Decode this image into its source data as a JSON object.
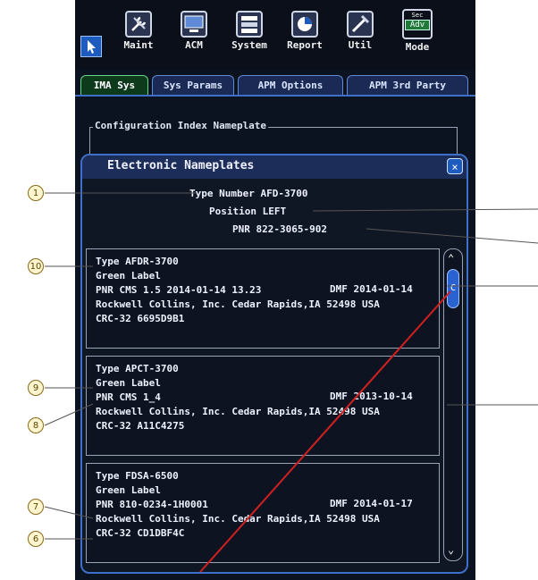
{
  "toolbar": {
    "buttons": [
      {
        "label": "Maint",
        "icon": "wrench-icon"
      },
      {
        "label": "ACM",
        "icon": "computer-icon"
      },
      {
        "label": "System",
        "icon": "network-icon"
      },
      {
        "label": "Report",
        "icon": "chart-icon"
      },
      {
        "label": "Util",
        "icon": "tools-icon"
      }
    ],
    "mode": {
      "label": "Mode",
      "sec": "Sec",
      "value": "Adv"
    }
  },
  "tabs": [
    {
      "label": "IMA Sys",
      "active": true
    },
    {
      "label": "Sys Params",
      "active": false
    },
    {
      "label": "APM Options",
      "active": false
    },
    {
      "label": "APM 3rd Party",
      "active": false
    }
  ],
  "config_frame": {
    "title": "Configuration Index Nameplate"
  },
  "dialog": {
    "title": "Electronic Nameplates",
    "close_label": "×",
    "header": {
      "type_line": "Type Number AFD-3700",
      "position_line": "Position LEFT",
      "pnr_line": "PNR 822-3065-902"
    },
    "cards": [
      {
        "type": "Type AFDR-3700",
        "label": "Green Label",
        "pnr": "PNR CMS 1.5 2014-01-14 13.23",
        "dmf": "DMF 2014-01-14",
        "mfr": "Rockwell Collins, Inc. Cedar Rapids,IA 52498 USA",
        "crc": "CRC-32 6695D9B1"
      },
      {
        "type": "Type APCT-3700",
        "label": "Green Label",
        "pnr": "PNR CMS 1_4",
        "dmf": "DMF 2013-10-14",
        "mfr": "Rockwell Collins, Inc. Cedar Rapids,IA 52498 USA",
        "crc": "CRC-32 A11C4275"
      },
      {
        "type": "Type FDSA-6500",
        "label": "Green Label",
        "pnr": "PNR 810-0234-1H0001",
        "dmf": "DMF 2014-01-17",
        "mfr": "Rockwell Collins, Inc. Cedar Rapids,IA 52498 USA",
        "crc": "CRC-32 CD1DBF4C"
      }
    ]
  },
  "scrollbar": {
    "up": "⌃",
    "thumb": "C",
    "down": "⌄"
  },
  "callouts": [
    "1",
    "10",
    "9",
    "8",
    "7",
    "6"
  ],
  "colors": {
    "screen_bg": "#0b1220",
    "accent": "#3f70c9",
    "active_tab": "#0e3a1c",
    "annotation_line": "#d02020"
  }
}
